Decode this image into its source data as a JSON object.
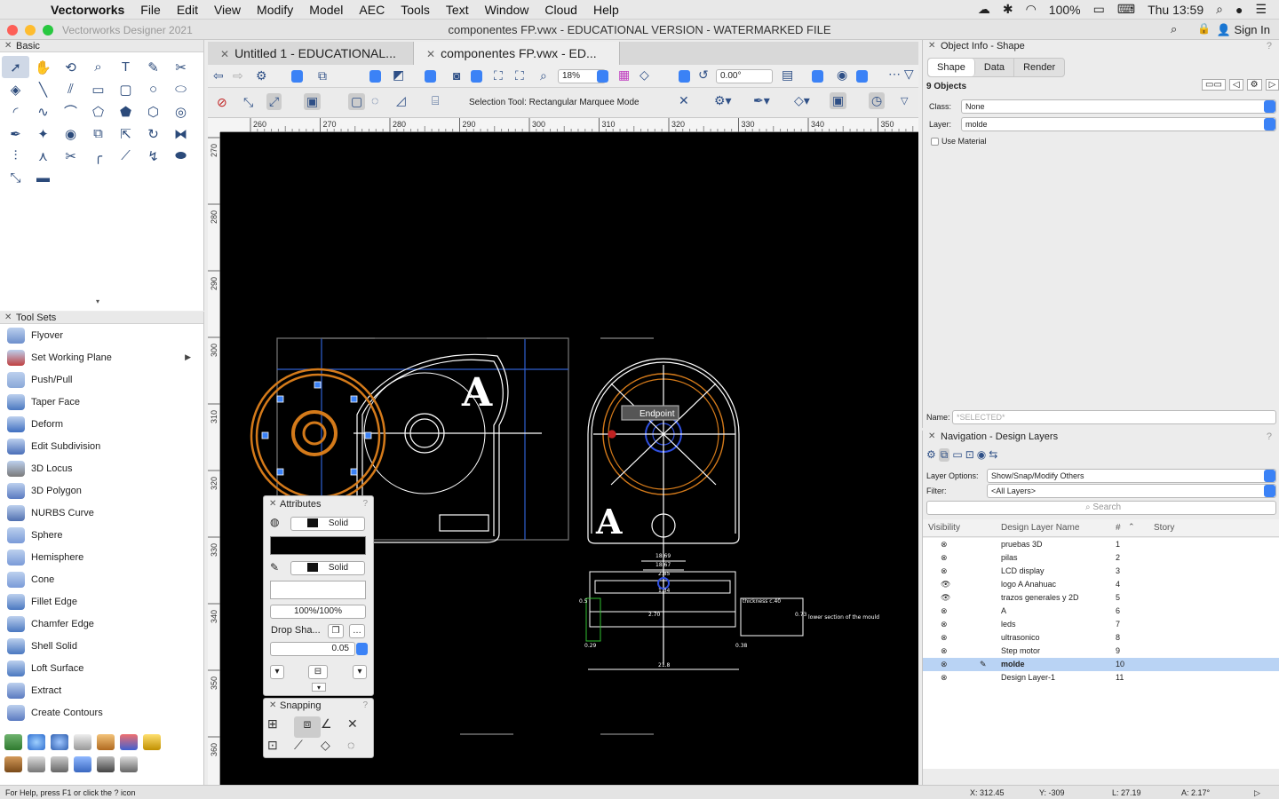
{
  "menubar": {
    "app": "Vectorworks",
    "items": [
      "File",
      "Edit",
      "View",
      "Modify",
      "Model",
      "AEC",
      "Tools",
      "Text",
      "Window",
      "Cloud",
      "Help"
    ],
    "battery": "100%",
    "clock": "Thu 13:59"
  },
  "window": {
    "app_title": "Vectorworks Designer 2021",
    "doc_title": "componentes FP.vwx - EDUCATIONAL VERSION - WATERMARKED FILE",
    "sign_in": "Sign In"
  },
  "tabs": [
    {
      "label": "Untitled 1 - EDUCATIONAL..."
    },
    {
      "label": "componentes FP.vwx - ED..."
    }
  ],
  "viewbar": {
    "zoom": "18%",
    "rotation": "0.00°"
  },
  "modebar": {
    "mode_text": "Selection Tool: Rectangular Marquee Mode"
  },
  "basic_palette": {
    "title": "Basic"
  },
  "toolsets": {
    "title": "Tool Sets",
    "items": [
      "Flyover",
      "Set Working Plane",
      "Push/Pull",
      "Taper Face",
      "Deform",
      "Edit Subdivision",
      "3D Locus",
      "3D Polygon",
      "NURBS Curve",
      "Sphere",
      "Hemisphere",
      "Cone",
      "Fillet Edge",
      "Chamfer Edge",
      "Shell Solid",
      "Loft Surface",
      "Extract",
      "Create Contours"
    ]
  },
  "ruler": {
    "h_ticks": [
      "260",
      "270",
      "280",
      "290",
      "300",
      "310",
      "320",
      "330",
      "340",
      "350"
    ],
    "v_ticks": [
      "270",
      "280",
      "290",
      "300",
      "310",
      "320",
      "330",
      "340",
      "350",
      "360"
    ]
  },
  "drawing": {
    "snap_hint": "Endpoint",
    "dims": [
      "18.69",
      "18.67",
      "2.85",
      "1.34",
      "21.8",
      "0.73",
      "2.70",
      "0.29",
      "0.38",
      "0.5"
    ],
    "thickness_note": "thickness c.40",
    "lower_note": "lower section of the mould"
  },
  "attributes": {
    "title": "Attributes",
    "fill": "Solid",
    "pen": "Solid",
    "opacity": "100%/100%",
    "drop_shadow": "Drop Sha...",
    "line_weight": "0.05"
  },
  "snapping": {
    "title": "Snapping"
  },
  "object_info": {
    "title": "Object Info - Shape",
    "tabs": [
      "Shape",
      "Data",
      "Render"
    ],
    "count": "9 Objects",
    "class_label": "Class:",
    "class_value": "None",
    "layer_label": "Layer:",
    "layer_value": "molde",
    "use_material": "Use Material",
    "name_label": "Name:",
    "name_value": "*SELECTED*"
  },
  "navigation": {
    "title": "Navigation - Design Layers",
    "layer_options_label": "Layer Options:",
    "layer_options": "Show/Snap/Modify Others",
    "filter_label": "Filter:",
    "filter": "<All Layers>",
    "search_placeholder": "Search",
    "col_visibility": "Visibility",
    "col_name": "Design Layer Name",
    "col_num": "#",
    "col_story": "Story",
    "layers": [
      {
        "name": "pruebas 3D",
        "num": "1"
      },
      {
        "name": "pilas",
        "num": "2"
      },
      {
        "name": "LCD display",
        "num": "3"
      },
      {
        "name": "logo A Anahuac",
        "num": "4"
      },
      {
        "name": "trazos generales y 2D",
        "num": "5"
      },
      {
        "name": "A",
        "num": "6"
      },
      {
        "name": "leds",
        "num": "7"
      },
      {
        "name": "ultrasonico",
        "num": "8"
      },
      {
        "name": "Step motor",
        "num": "9"
      },
      {
        "name": "molde",
        "num": "10"
      },
      {
        "name": "Design Layer-1",
        "num": "11"
      }
    ]
  },
  "status": {
    "help": "For Help, press F1 or click the ? icon",
    "x": "X: 312.45",
    "y": "Y: -309",
    "l": "L: 27.19",
    "a": "A: 2.17°"
  }
}
